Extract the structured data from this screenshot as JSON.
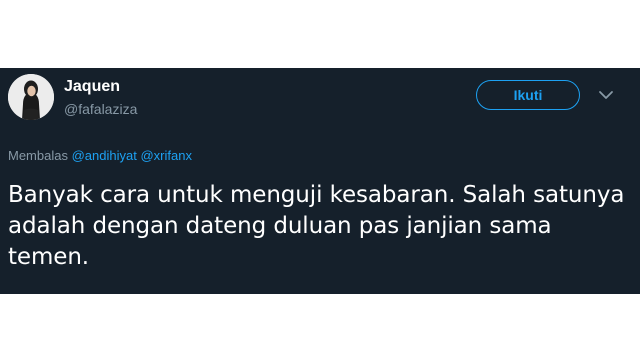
{
  "tweet": {
    "display_name": "Jaquen",
    "screen_name": "@fafalaziza",
    "follow_label": "Ikuti",
    "reply_prefix": "Membalas",
    "reply_mentions": [
      "@andihiyat",
      "@xrifanx"
    ],
    "text": "Banyak cara untuk menguji kesabaran. Salah satunya adalah dengan dateng duluan pas janjian sama temen."
  },
  "icons": {
    "avatar": "profile-photo",
    "menu": "chevron-down-icon"
  },
  "colors": {
    "card_background": "#15202b",
    "accent": "#1da1f2",
    "secondary_text": "#8899a6",
    "primary_text": "#ffffff"
  }
}
